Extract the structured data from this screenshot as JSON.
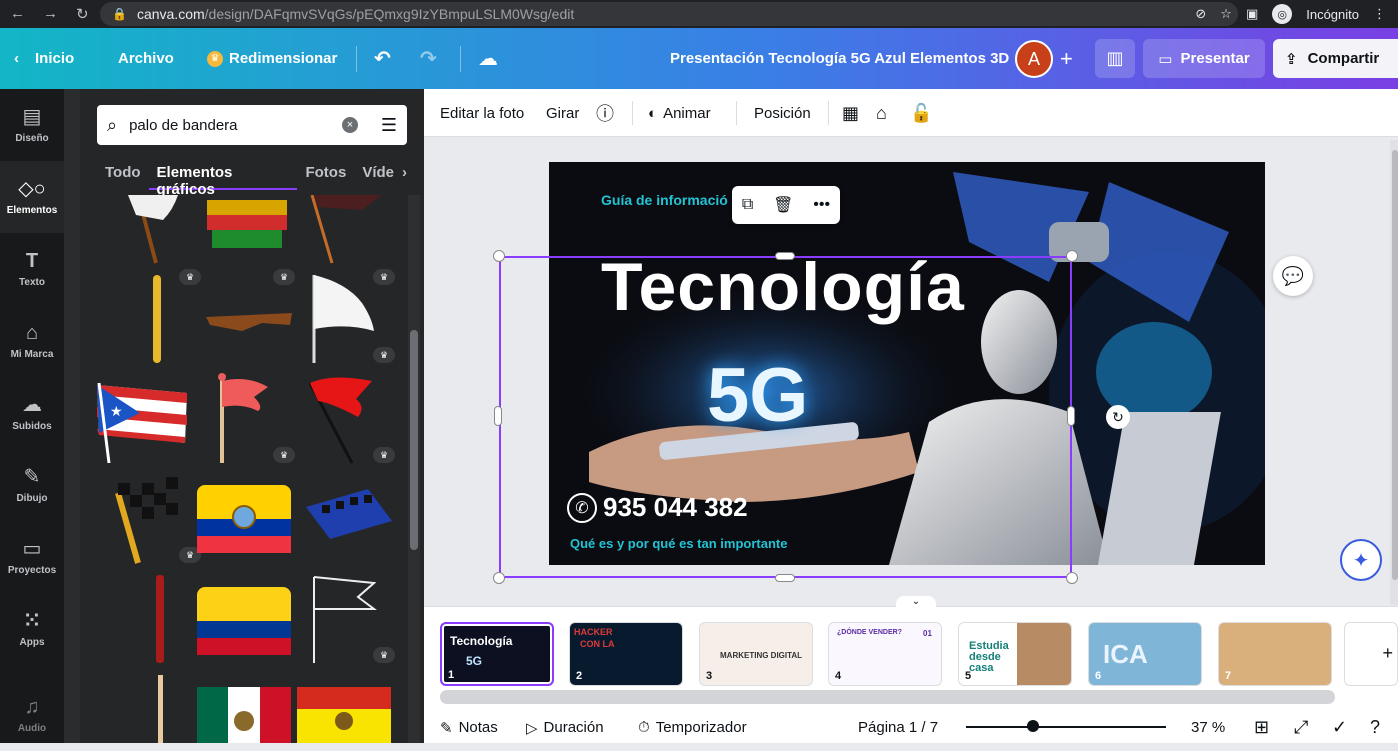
{
  "browser": {
    "url_host": "canva.com",
    "url_path": "/design/DAFqmvSVqGs/pEQmxg9IzYBmpuLSLM0Wsg/edit",
    "profile_label": "Incógnito"
  },
  "topbar": {
    "home": "Inicio",
    "file": "Archivo",
    "resize": "Redimensionar",
    "doc_title": "Presentación Tecnología 5G Azul Elementos 3D",
    "avatar_letter": "A",
    "present": "Presentar",
    "share": "Compartir"
  },
  "rail": [
    {
      "label": "Diseño",
      "icon": "layout-icon"
    },
    {
      "label": "Elementos",
      "icon": "shapes-icon"
    },
    {
      "label": "Texto",
      "icon": "text-icon"
    },
    {
      "label": "Mi Marca",
      "icon": "brand-icon"
    },
    {
      "label": "Subidos",
      "icon": "upload-icon"
    },
    {
      "label": "Dibujo",
      "icon": "draw-icon"
    },
    {
      "label": "Proyectos",
      "icon": "folder-icon"
    },
    {
      "label": "Apps",
      "icon": "apps-icon"
    },
    {
      "label": "Audio",
      "icon": "audio-icon"
    }
  ],
  "search": {
    "value": "palo de bandera"
  },
  "tabs": [
    "Todo",
    "Elementos gráficos",
    "Fotos",
    "Víde"
  ],
  "toolbar": {
    "edit_photo": "Editar la foto",
    "rotate": "Girar",
    "animate": "Animar",
    "position": "Posición"
  },
  "slide": {
    "subtitle": "Guía de informació",
    "title": "Tecnología",
    "big_text": "5G",
    "phone": "935 044 382",
    "tagline": "Qué es y por qué es tan importante"
  },
  "pages": [
    {
      "num": "1",
      "label": "Tecnología",
      "label2": "5G"
    },
    {
      "num": "2",
      "label": "HACKER",
      "label2": "CON LA"
    },
    {
      "num": "3",
      "label": "MARKETING DIGITAL"
    },
    {
      "num": "4",
      "label": "¿DÓNDE VENDER?",
      "label2": "01"
    },
    {
      "num": "5",
      "label": "Estudia desde casa"
    },
    {
      "num": "6",
      "label": "ICA"
    },
    {
      "num": "7",
      "label": ""
    }
  ],
  "bottombar": {
    "notes": "Notas",
    "duration": "Duración",
    "timer": "Temporizador",
    "page_label": "Página 1 / 7",
    "zoom": "37 %"
  },
  "colors": {
    "accent": "#8b3dff",
    "cyan": "#24c3d3",
    "dark_panel": "#252627"
  }
}
